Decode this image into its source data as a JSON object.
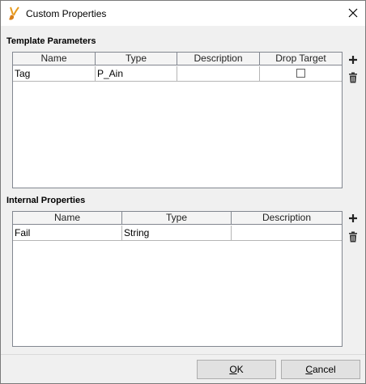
{
  "window": {
    "title": "Custom Properties"
  },
  "template_parameters": {
    "label": "Template Parameters",
    "columns": [
      "Name",
      "Type",
      "Description",
      "Drop Target"
    ],
    "rows": [
      {
        "name": "Tag",
        "type": "P_Ain",
        "description": "",
        "drop_target": false
      }
    ]
  },
  "internal_properties": {
    "label": "Internal Properties",
    "columns": [
      "Name",
      "Type",
      "Description"
    ],
    "rows": [
      {
        "name": "Fail",
        "type": "String",
        "description": ""
      }
    ]
  },
  "buttons": {
    "ok": {
      "mnemonic": "O",
      "rest": "K"
    },
    "cancel": {
      "mnemonic": "C",
      "rest": "ancel"
    }
  },
  "icons": {
    "app": "brush-icon",
    "close": "close-icon",
    "add": "plus-icon",
    "delete": "trash-icon"
  }
}
